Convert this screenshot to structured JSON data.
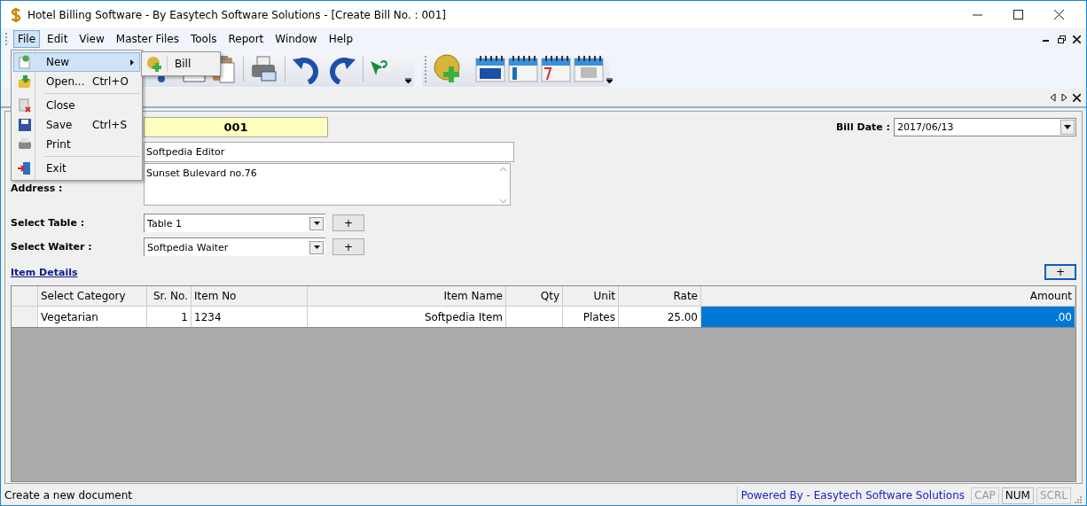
{
  "window": {
    "title": "Hotel Billing Software - By Easytech Software Solutions - [Create Bill No. : 001]"
  },
  "menu_bar": [
    {
      "label": "File",
      "selected": true
    },
    {
      "label": "Edit",
      "selected": false
    },
    {
      "label": "View",
      "selected": false
    },
    {
      "label": "Master Files",
      "selected": false
    },
    {
      "label": "Tools",
      "selected": false
    },
    {
      "label": "Report",
      "selected": false
    },
    {
      "label": "Window",
      "selected": false
    },
    {
      "label": "Help",
      "selected": false
    }
  ],
  "file_menu": [
    {
      "kind": "item",
      "label": "New",
      "submenu": true,
      "selected": true
    },
    {
      "kind": "item",
      "label": "Open...",
      "shortcut": "Ctrl+O",
      "submenu": false,
      "selected": false
    },
    {
      "kind": "separator"
    },
    {
      "kind": "item",
      "label": "Close",
      "submenu": false,
      "selected": false
    },
    {
      "kind": "item",
      "label": "Save",
      "shortcut": "Ctrl+S",
      "submenu": false,
      "selected": false
    },
    {
      "kind": "item",
      "label": "Print",
      "submenu": false,
      "selected": false
    },
    {
      "kind": "separator"
    },
    {
      "kind": "item",
      "label": "Exit",
      "submenu": false,
      "selected": false
    }
  ],
  "new_submenu": [
    {
      "label": "Bill"
    }
  ],
  "form": {
    "bill_no": "001",
    "customer_name": "Softpedia Editor",
    "address_label": "Address :",
    "address": "Sunset Bulevard no.76",
    "bill_date_label": "Bill Date :",
    "bill_date": "2017/06/13",
    "table_label": "Select Table :",
    "table": "Table 1",
    "waiter_label": "Select Waiter :",
    "waiter": "Softpedia Waiter",
    "add_button": "+",
    "item_details_link": "Item Details",
    "add_item_button": "+"
  },
  "table": {
    "columns": [
      {},
      {
        "label": "Select Category"
      },
      {
        "label": "Sr. No."
      },
      {
        "label": "Item No"
      },
      {
        "label": "Item Name"
      },
      {
        "label": "Qty"
      },
      {
        "label": "Unit"
      },
      {
        "label": "Rate"
      },
      {
        "label": "Amount"
      }
    ],
    "rows": [
      {
        "cells": [
          {
            "selected": false
          },
          {
            "text": "Vegetarian",
            "selected": false
          },
          {
            "text": "1",
            "selected": false
          },
          {
            "text": "1234",
            "selected": false
          },
          {
            "text": "Softpedia Item",
            "selected": false
          },
          {
            "selected": false
          },
          {
            "text": "Plates",
            "selected": false
          },
          {
            "text": "25.00",
            "selected": false
          },
          {
            "text": ".00",
            "selected": true
          }
        ]
      }
    ]
  },
  "status_bar": {
    "message": "Create a new document",
    "powered_by": "Powered By - Easytech Software Solutions",
    "indicators": [
      {
        "label": "CAP",
        "on": false
      },
      {
        "label": "NUM",
        "on": true
      },
      {
        "label": "SCRL",
        "on": false
      }
    ]
  }
}
